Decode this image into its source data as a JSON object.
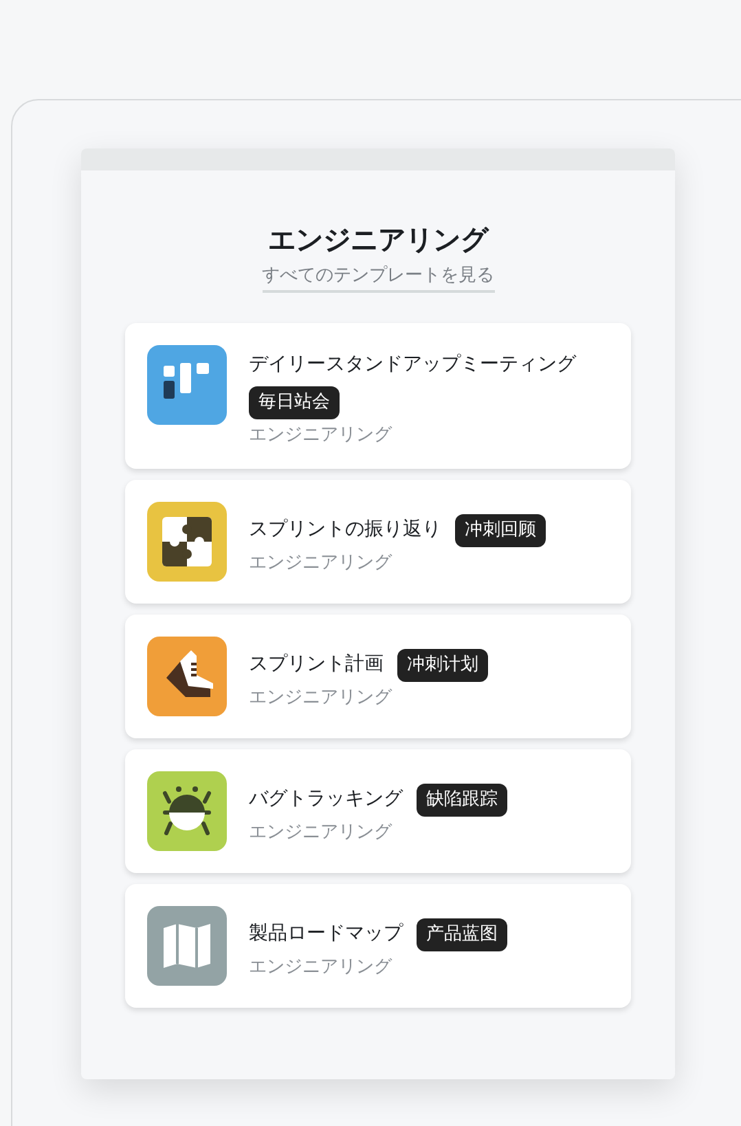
{
  "section": {
    "title": "エンジニアリング",
    "link": "すべてのテンプレートを見る"
  },
  "templates": [
    {
      "kind": "board",
      "color": "#4fa6e3",
      "title": "デイリースタンドアップミーティング",
      "tag": "毎日站会",
      "category": "エンジニアリング"
    },
    {
      "kind": "puzzle",
      "color": "#e8c341",
      "title": "スプリントの振り返り",
      "tag": "冲刺回顾",
      "category": "エンジニアリング"
    },
    {
      "kind": "shoe",
      "color": "#f09e39",
      "title": "スプリント計画",
      "tag": "冲刺计划",
      "category": "エンジニアリング"
    },
    {
      "kind": "bug",
      "color": "#afd04f",
      "title": "バグトラッキング",
      "tag": "缺陷跟踪",
      "category": "エンジニアリング"
    },
    {
      "kind": "map",
      "color": "#93a3a5",
      "title": "製品ロードマップ",
      "tag": "产品蓝图",
      "category": "エンジニアリング"
    }
  ]
}
